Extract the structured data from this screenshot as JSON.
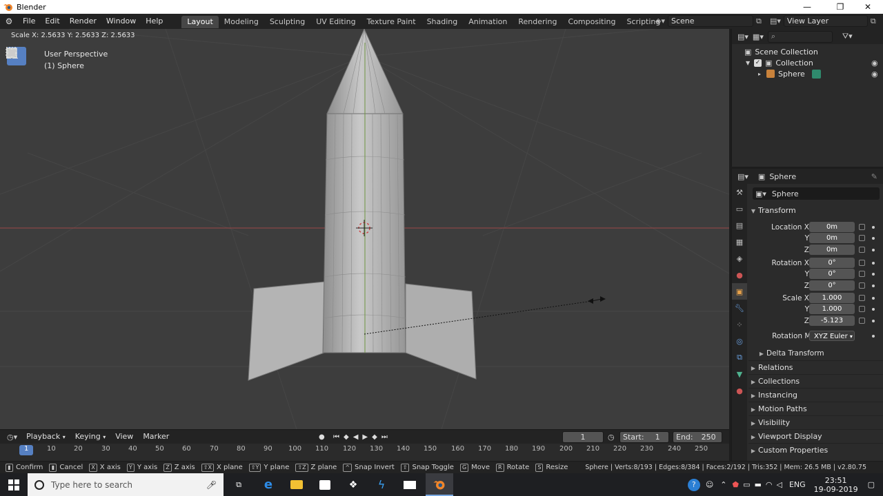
{
  "window": {
    "title": "Blender"
  },
  "menus": [
    "File",
    "Edit",
    "Render",
    "Window",
    "Help"
  ],
  "workspaces": [
    "Layout",
    "Modeling",
    "Sculpting",
    "UV Editing",
    "Texture Paint",
    "Shading",
    "Animation",
    "Rendering",
    "Compositing",
    "Scripting"
  ],
  "active_workspace": "Layout",
  "scene": {
    "name": "Scene",
    "view_layer": "View Layer"
  },
  "viewport": {
    "header_text": "Scale X: 2.5633   Y: 2.5633   Z: 2.5633",
    "perspective": "User Perspective",
    "object_label": "(1) Sphere"
  },
  "outliner": {
    "root": "Scene Collection",
    "collection": "Collection",
    "object": "Sphere"
  },
  "properties": {
    "header_object": "Sphere",
    "name_field": "Sphere",
    "transform_title": "Transform",
    "location": {
      "label": "Location X",
      "x": "0m",
      "y": "0m",
      "z": "0m"
    },
    "rotation": {
      "label": "Rotation X",
      "x": "0°",
      "y": "0°",
      "z": "0°"
    },
    "scale": {
      "label": "Scale X",
      "x": "1.000",
      "y": "1.000",
      "z": "-5.123"
    },
    "axis_y": "Y",
    "axis_z": "Z",
    "rotation_mode_label": "Rotation Mode",
    "rotation_mode": "XYZ Euler",
    "delta": "Delta Transform",
    "sections": [
      "Relations",
      "Collections",
      "Instancing",
      "Motion Paths",
      "Visibility",
      "Viewport Display",
      "Custom Properties"
    ]
  },
  "timeline": {
    "playback": "Playback",
    "keying": "Keying",
    "view": "View",
    "marker": "Marker",
    "current_frame": "1",
    "start_label": "Start:",
    "start": "1",
    "end_label": "End:",
    "end": "250",
    "ruler_ticks": [
      "1",
      "10",
      "20",
      "30",
      "40",
      "50",
      "60",
      "70",
      "80",
      "90",
      "100",
      "110",
      "120",
      "130",
      "140",
      "150",
      "160",
      "170",
      "180",
      "190",
      "200",
      "210",
      "220",
      "230",
      "240",
      "250"
    ]
  },
  "statusbar": {
    "confirm": "Confirm",
    "cancel": "Cancel",
    "items": [
      {
        "key": "X",
        "label": "X axis"
      },
      {
        "key": "Y",
        "label": "Y axis"
      },
      {
        "key": "Z",
        "label": "Z axis"
      },
      {
        "key": "⇧X",
        "label": "X plane"
      },
      {
        "key": "⇧Y",
        "label": "Y plane"
      },
      {
        "key": "⇧Z",
        "label": "Z plane"
      },
      {
        "key": "^",
        "label": "Snap Invert"
      },
      {
        "key": "⇧",
        "label": "Snap Toggle"
      },
      {
        "key": "G",
        "label": "Move"
      },
      {
        "key": "R",
        "label": "Rotate"
      },
      {
        "key": "S",
        "label": "Resize"
      }
    ],
    "stats": "Sphere | Verts:8/193 | Edges:8/384 | Faces:2/192 | Tris:352 | Mem: 26.5 MB | v2.80.75"
  },
  "taskbar": {
    "search_placeholder": "Type here to search",
    "language": "ENG",
    "time": "23:51",
    "date": "19-09-2019"
  },
  "colors": {
    "accent": "#5680c2",
    "viewport_bg": "#3d3d3d",
    "header_bg": "#232323",
    "panel_bg": "#2b2b2b",
    "x_axis": "#b5474c",
    "y_axis": "#6e9441"
  }
}
